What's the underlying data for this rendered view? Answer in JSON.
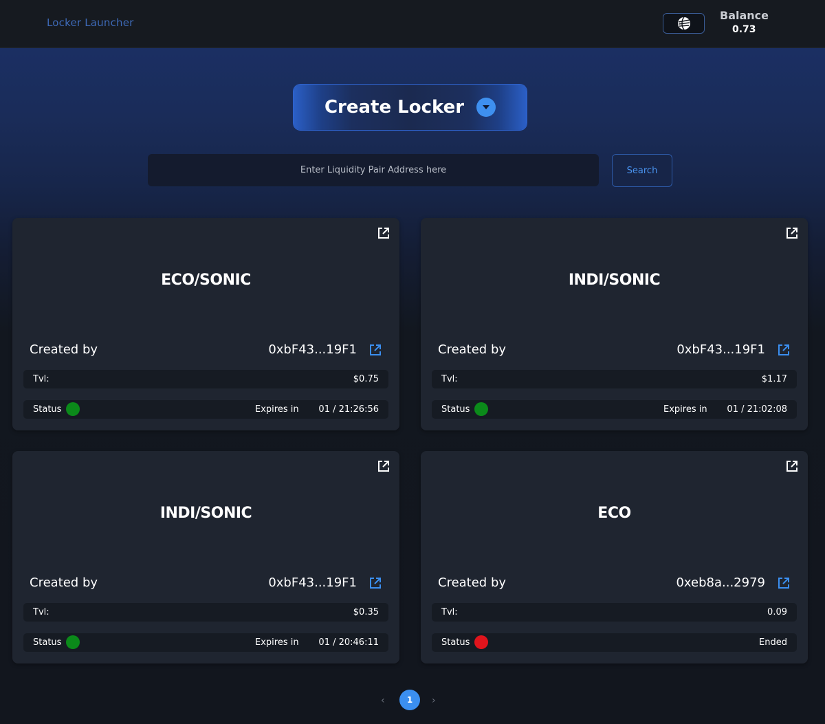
{
  "header": {
    "brand": "Locker Launcher",
    "wallet_icon": "sonic-logo-icon",
    "balance_label": "Balance",
    "balance_value": "0.73"
  },
  "hero": {
    "create_label": "Create Locker",
    "search_placeholder": "Enter Liquidity Pair Address here",
    "search_button": "Search"
  },
  "cards": [
    {
      "pair": "ECO/SONIC",
      "created_label": "Created by",
      "creator": "0xbF43...19F1",
      "tvl_label": "Tvl:",
      "tvl": "$0.75",
      "status_label": "Status",
      "status_color": "#0b8a1a",
      "expires_label": "Expires in",
      "expires": "01 / 21:26:56"
    },
    {
      "pair": "INDI/SONIC",
      "created_label": "Created by",
      "creator": "0xbF43...19F1",
      "tvl_label": "Tvl:",
      "tvl": "$1.17",
      "status_label": "Status",
      "status_color": "#0b8a1a",
      "expires_label": "Expires in",
      "expires": "01 / 21:02:08"
    },
    {
      "pair": "INDI/SONIC",
      "created_label": "Created by",
      "creator": "0xbF43...19F1",
      "tvl_label": "Tvl:",
      "tvl": "$0.35",
      "status_label": "Status",
      "status_color": "#0b8a1a",
      "expires_label": "Expires in",
      "expires": "01 / 20:46:11"
    },
    {
      "pair": "ECO",
      "created_label": "Created by",
      "creator": "0xeb8a...2979",
      "tvl_label": "Tvl:",
      "tvl": "0.09",
      "status_label": "Status",
      "status_color": "#e0141c",
      "expires_label": "",
      "expires": "Ended"
    }
  ],
  "pagination": {
    "prev": "‹",
    "current": "1",
    "next": "›"
  },
  "colors": {
    "accent": "#3b8ff0",
    "link": "#3b8ff0",
    "active_status": "#0b8a1a",
    "ended_status": "#e0141c"
  }
}
